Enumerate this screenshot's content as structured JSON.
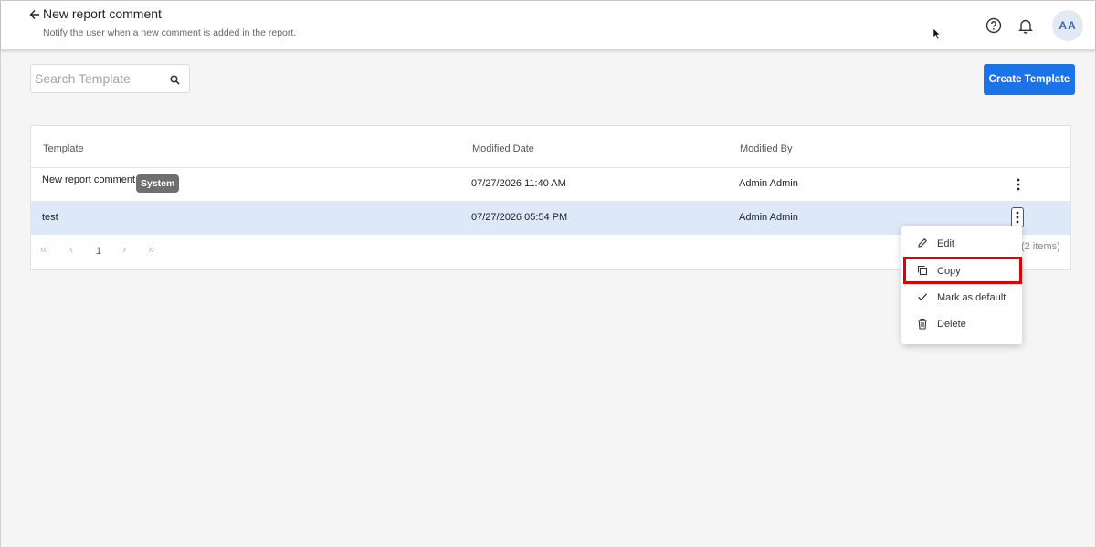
{
  "header": {
    "title": "New report comment",
    "subtitle": "Notify the user when a new comment is added in the report.",
    "avatar_initials": "AA"
  },
  "toolbar": {
    "search_placeholder": "Search Template",
    "create_label": "Create Template"
  },
  "table": {
    "columns": [
      "Template",
      "Modified Date",
      "Modified By"
    ],
    "rows": [
      {
        "template": "New report comment",
        "badge": "System",
        "modified_date": "07/27/2026 11:40 AM",
        "modified_by": "Admin Admin"
      },
      {
        "template": "test",
        "modified_date": "07/27/2026 05:54 PM",
        "modified_by": "Admin Admin"
      }
    ],
    "pagination": {
      "first": "«",
      "prev": "‹",
      "page": "1",
      "next": "›",
      "last": "»",
      "items_count": "(2 items)"
    }
  },
  "context_menu": {
    "items": [
      {
        "label": "Edit",
        "icon": "pencil-icon"
      },
      {
        "label": "Copy",
        "icon": "copy-icon"
      },
      {
        "label": "Mark as default",
        "icon": "check-icon"
      },
      {
        "label": "Delete",
        "icon": "trash-icon"
      }
    ]
  },
  "colors": {
    "primary": "#1a73e8",
    "selected_row": "#dde8f8",
    "highlight": "#e00000",
    "badge": "#6f6f6f"
  }
}
